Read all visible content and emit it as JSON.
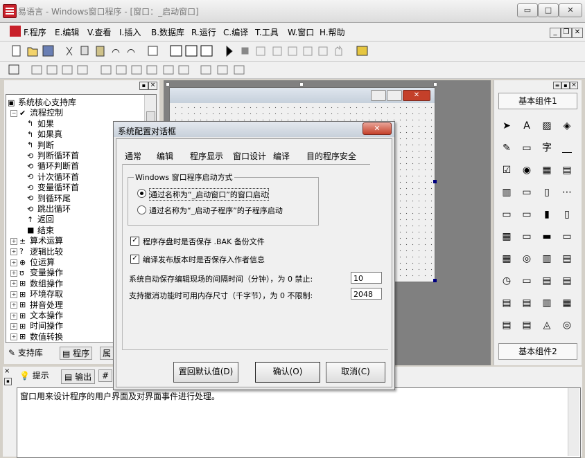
{
  "window": {
    "title": "易语言 - Windows窗口程序 - [窗口：_启动窗口]",
    "min": "▭",
    "max": "□",
    "close": "✕"
  },
  "menu": {
    "items": [
      "F.程序",
      "E.编辑",
      "V.查看",
      "I.插入",
      "B.数据库",
      "R.运行",
      "C.编译",
      "T.工具",
      "W.窗口",
      "H.帮助"
    ],
    "mdi": [
      "_",
      "❐",
      "✕"
    ]
  },
  "left_panel": {
    "tree": [
      {
        "label": "系统核心支持库",
        "level": 0,
        "icon": "library-icon"
      },
      {
        "label": "流程控制",
        "level": 1,
        "icon": "checkmark-icon",
        "expander": "−"
      },
      {
        "label": "如果",
        "level": 2,
        "icon": "flow-icon"
      },
      {
        "label": "如果真",
        "level": 2,
        "icon": "flow-icon"
      },
      {
        "label": "判断",
        "level": 2,
        "icon": "flow-icon"
      },
      {
        "label": "判断循环首",
        "level": 2,
        "icon": "loop-icon"
      },
      {
        "label": "循环判断首",
        "level": 2,
        "icon": "loop-icon"
      },
      {
        "label": "计次循环首",
        "level": 2,
        "icon": "loop-icon"
      },
      {
        "label": "变量循环首",
        "level": 2,
        "icon": "loop-icon"
      },
      {
        "label": "到循环尾",
        "level": 2,
        "icon": "loop-icon"
      },
      {
        "label": "跳出循环",
        "level": 2,
        "icon": "loop-icon"
      },
      {
        "label": "返回",
        "level": 2,
        "icon": "return-icon"
      },
      {
        "label": "结束",
        "level": 2,
        "icon": "end-icon"
      },
      {
        "label": "算术运算",
        "level": 1,
        "icon": "arith-icon",
        "expander": "+"
      },
      {
        "label": "逻辑比较",
        "level": 1,
        "icon": "question-icon",
        "expander": "+"
      },
      {
        "label": "位运算",
        "level": 1,
        "icon": "bit-icon",
        "expander": "+"
      },
      {
        "label": "变量操作",
        "level": 1,
        "icon": "variable-icon",
        "expander": "+"
      },
      {
        "label": "数组操作",
        "level": 1,
        "icon": "array-icon",
        "expander": "+"
      },
      {
        "label": "环境存取",
        "level": 1,
        "icon": "array-icon",
        "expander": "+"
      },
      {
        "label": "拼音处理",
        "level": 1,
        "icon": "array-icon",
        "expander": "+"
      },
      {
        "label": "文本操作",
        "level": 1,
        "icon": "array-icon",
        "expander": "+"
      },
      {
        "label": "时间操作",
        "level": 1,
        "icon": "array-icon",
        "expander": "+"
      },
      {
        "label": "数值转换",
        "level": 1,
        "icon": "array-icon",
        "expander": "+"
      }
    ],
    "tabs": [
      "支持库",
      "程序",
      "属"
    ]
  },
  "right_panel": {
    "header": "基本组件1",
    "footer": "基本组件2"
  },
  "bottom_panel": {
    "tabs": [
      "提示",
      "输出",
      "#"
    ],
    "text": "窗口用来设计程序的用户界面及对界面事件进行处理。"
  },
  "dialog": {
    "title": "系统配置对话框",
    "close": "✕",
    "tabs": [
      "通常",
      "编辑",
      "程序显示",
      "窗口设计",
      "编译",
      "目的程序安全"
    ],
    "group_title": "Windows 窗口程序启动方式",
    "radio1": "通过名称为“_启动窗口”的窗口启动",
    "radio2": "通过名称为“_启动子程序”的子程序启动",
    "check1": "程序存盘时是否保存 .BAK 备份文件",
    "check2": "编译发布版本时是否保存入作者信息",
    "autosave_label": "系统自动保存编辑现场的间隔时间（分钟），为 0 禁止:",
    "autosave_value": "10",
    "undo_label": "支持撤消功能时可用内存尺寸（千字节），为 0 不限制:",
    "undo_value": "2048",
    "btn_reset": "置回默认值(D)",
    "btn_ok": "确认(O)",
    "btn_cancel": "取消(C)"
  }
}
